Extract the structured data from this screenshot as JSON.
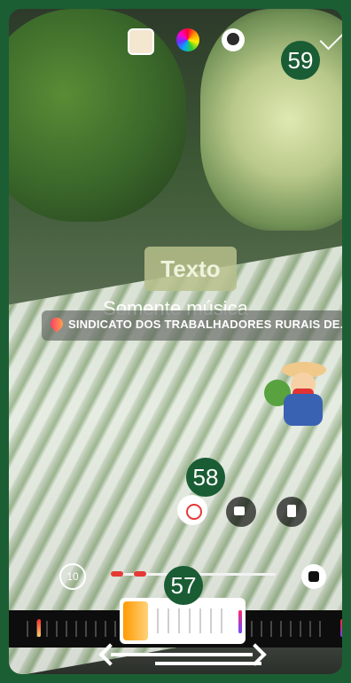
{
  "top_icons": [
    "sticker-icon",
    "color-wheel-icon",
    "face-filter-icon"
  ],
  "confirm_icon": "check-icon",
  "badges": {
    "top_right": "59",
    "middle": "58",
    "bottom": "57"
  },
  "text_chip": {
    "label": "Texto"
  },
  "music": {
    "label": "Somente música"
  },
  "location": {
    "label": "SINDICATO DOS TRABALHADORES RURAIS DE..."
  },
  "controls": {
    "timer": "10"
  },
  "timeline": {
    "selection_start": 0.27,
    "selection_end": 0.67
  }
}
